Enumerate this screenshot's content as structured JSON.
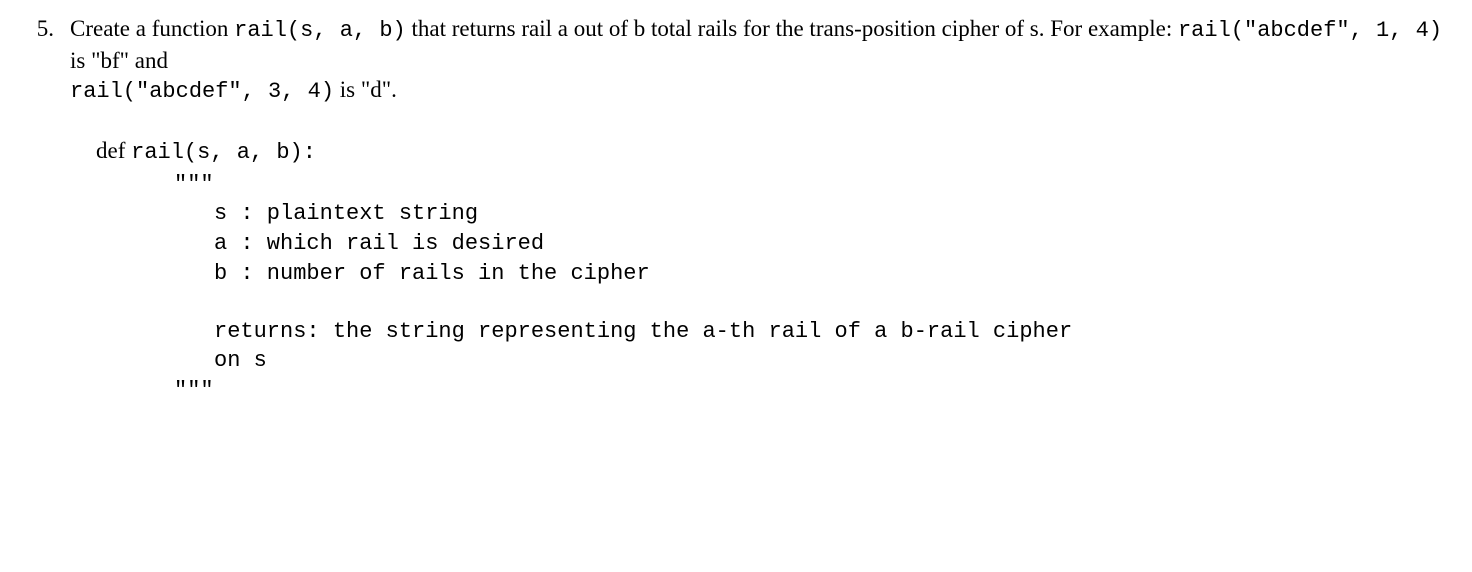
{
  "problem": {
    "number": "5.",
    "text_parts": {
      "p1": "Create a function ",
      "code1": "rail(s, a, b)",
      "p2": " that returns rail a out of b total rails for the trans-position cipher of s. For example: ",
      "code2": "rail(\"abcdef\", 1, 4)",
      "p3": " is \"bf\" and ",
      "code3": "rail(\"abcdef\", 3, 4)",
      "p4": " is \"d\"."
    },
    "code": {
      "def_prefix": "def ",
      "def_signature": "rail(s, a, b):",
      "docstring_open": "\"\"\"",
      "param_s": "s : plaintext string",
      "param_a": "a : which rail is desired",
      "param_b": "b : number of rails in the cipher",
      "returns_line1": "returns: the string representing the a-th rail of a b-rail cipher",
      "returns_line2": "on s",
      "docstring_close": "\"\"\""
    }
  }
}
